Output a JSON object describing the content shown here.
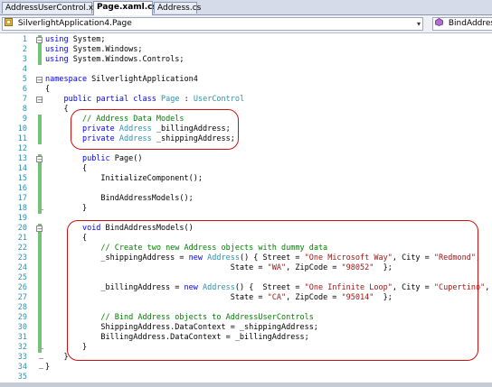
{
  "tabs": [
    {
      "label": "AddressUserControl.xaml"
    },
    {
      "label": "Page.xaml.cs"
    },
    {
      "label": "Address.cs"
    }
  ],
  "active_tab_index": 1,
  "navbar": {
    "left_dropdown": {
      "icon": "class-icon",
      "label": "SilverlightApplication4.Page"
    },
    "right_dropdown": {
      "icon": "method-icon",
      "label": "BindAddress"
    }
  },
  "code": {
    "lines": [
      {
        "num": "1",
        "text": "using System;"
      },
      {
        "num": "2",
        "text": "using System.Windows;"
      },
      {
        "num": "3",
        "text": "using System.Windows.Controls;"
      },
      {
        "num": "4",
        "text": ""
      },
      {
        "num": "5",
        "text": "namespace SilverlightApplication4"
      },
      {
        "num": "6",
        "text": "{"
      },
      {
        "num": "7",
        "text": "    public partial class Page : UserControl"
      },
      {
        "num": "8",
        "text": "    {"
      },
      {
        "num": "9",
        "text": "        // Address Data Models"
      },
      {
        "num": "10",
        "text": "        private Address _billingAddress;"
      },
      {
        "num": "11",
        "text": "        private Address _shippingAddress;"
      },
      {
        "num": "12",
        "text": ""
      },
      {
        "num": "13",
        "text": "        public Page()"
      },
      {
        "num": "14",
        "text": "        {"
      },
      {
        "num": "15",
        "text": "            InitializeComponent();"
      },
      {
        "num": "16",
        "text": ""
      },
      {
        "num": "17",
        "text": "            BindAddressModels();"
      },
      {
        "num": "18",
        "text": "        }"
      },
      {
        "num": "19",
        "text": ""
      },
      {
        "num": "20",
        "text": "        void BindAddressModels()"
      },
      {
        "num": "21",
        "text": "        {"
      },
      {
        "num": "22",
        "text": "            // Create two new Address objects with dummy data"
      },
      {
        "num": "23",
        "text": "            _shippingAddress = new Address() { Street = \"One Microsoft Way\", City = \"Redmond\","
      },
      {
        "num": "24",
        "text": "                                        State = \"WA\", ZipCode = \"98052\"  };"
      },
      {
        "num": "25",
        "text": ""
      },
      {
        "num": "26",
        "text": "            _billingAddress = new Address() {  Street = \"One Infinite Loop\", City = \"Cupertino\","
      },
      {
        "num": "27",
        "text": "                                        State = \"CA\", ZipCode = \"95014\"  };"
      },
      {
        "num": "28",
        "text": ""
      },
      {
        "num": "29",
        "text": "            // Bind Address objects to AddressUserControls"
      },
      {
        "num": "30",
        "text": "            ShippingAddress.DataContext = _shippingAddress;"
      },
      {
        "num": "31",
        "text": "            BillingAddress.DataContext = _billingAddress;"
      },
      {
        "num": "32",
        "text": "        }"
      },
      {
        "num": "33",
        "text": "    }"
      },
      {
        "num": "34",
        "text": "}"
      },
      {
        "num": "35",
        "text": ""
      }
    ]
  },
  "colors": {
    "keyword": "#0000ff",
    "string": "#a31515",
    "comment": "#008000",
    "type": "#2b91af",
    "line_number": "#2b91af",
    "change_bar": "#74c277",
    "highlight_outline": "#cc1111"
  }
}
